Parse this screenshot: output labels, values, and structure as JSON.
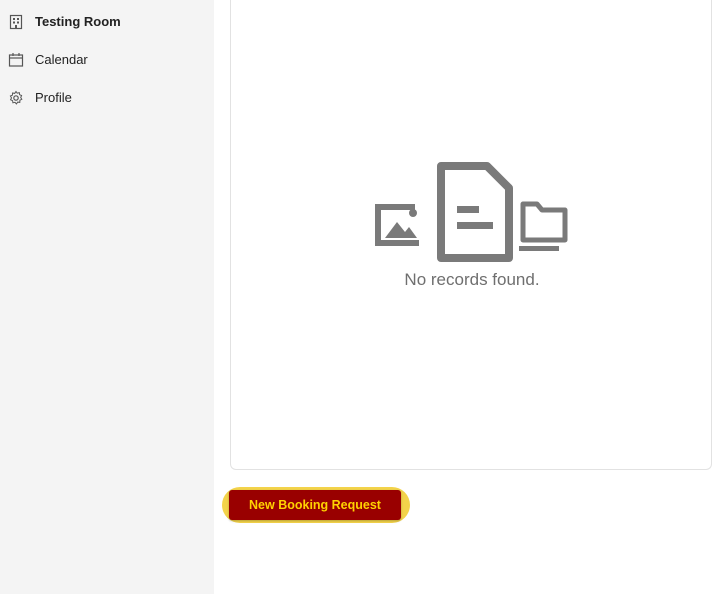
{
  "sidebar": {
    "items": [
      {
        "label": "Testing Room",
        "icon": "building-icon",
        "active": true
      },
      {
        "label": "Calendar",
        "icon": "calendar-icon",
        "active": false
      },
      {
        "label": "Profile",
        "icon": "gear-icon",
        "active": false
      }
    ]
  },
  "main": {
    "empty_state": {
      "message": "No records found.",
      "icons": [
        "image-icon",
        "document-icon",
        "folder-icon"
      ]
    },
    "new_booking_label": "New Booking Request"
  },
  "colors": {
    "sidebar_bg": "#f4f4f4",
    "button_bg": "#990000",
    "button_text": "#ffd200",
    "button_glow": "#f3d34a",
    "empty_icon": "#7a7a7a",
    "empty_text": "#6f6f6f"
  }
}
